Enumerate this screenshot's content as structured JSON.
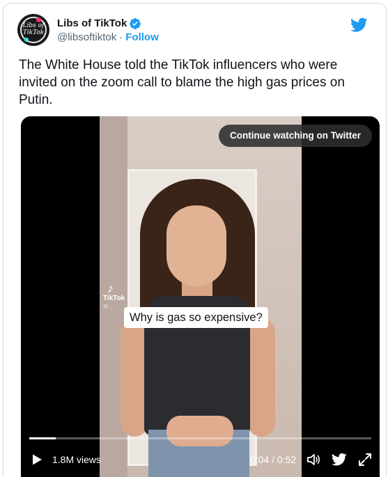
{
  "account": {
    "avatar_text": "Libs of TikTok",
    "display_name": "Libs of TikTok",
    "handle": "@libsoftiktok",
    "separator": "·",
    "follow_label": "Follow"
  },
  "tweet": {
    "text": "The White House told the TikTok influencers who were invited on the zoom call to blame the high gas prices on Putin."
  },
  "video": {
    "continue_label": "Continue watching on Twitter",
    "watermark": "TikTok",
    "watermark_user": "@...",
    "caption": "Why is gas so expensive?",
    "views": "1.8M views",
    "time": "0:04 / 0:52",
    "progress_fraction": 0.077
  },
  "colors": {
    "accent": "#1d9bf0",
    "text": "#0f1419",
    "muted": "#536471"
  },
  "icons": [
    "verified-badge-icon",
    "twitter-bird-icon",
    "play-icon",
    "volume-icon",
    "twitter-share-icon",
    "fullscreen-icon"
  ]
}
